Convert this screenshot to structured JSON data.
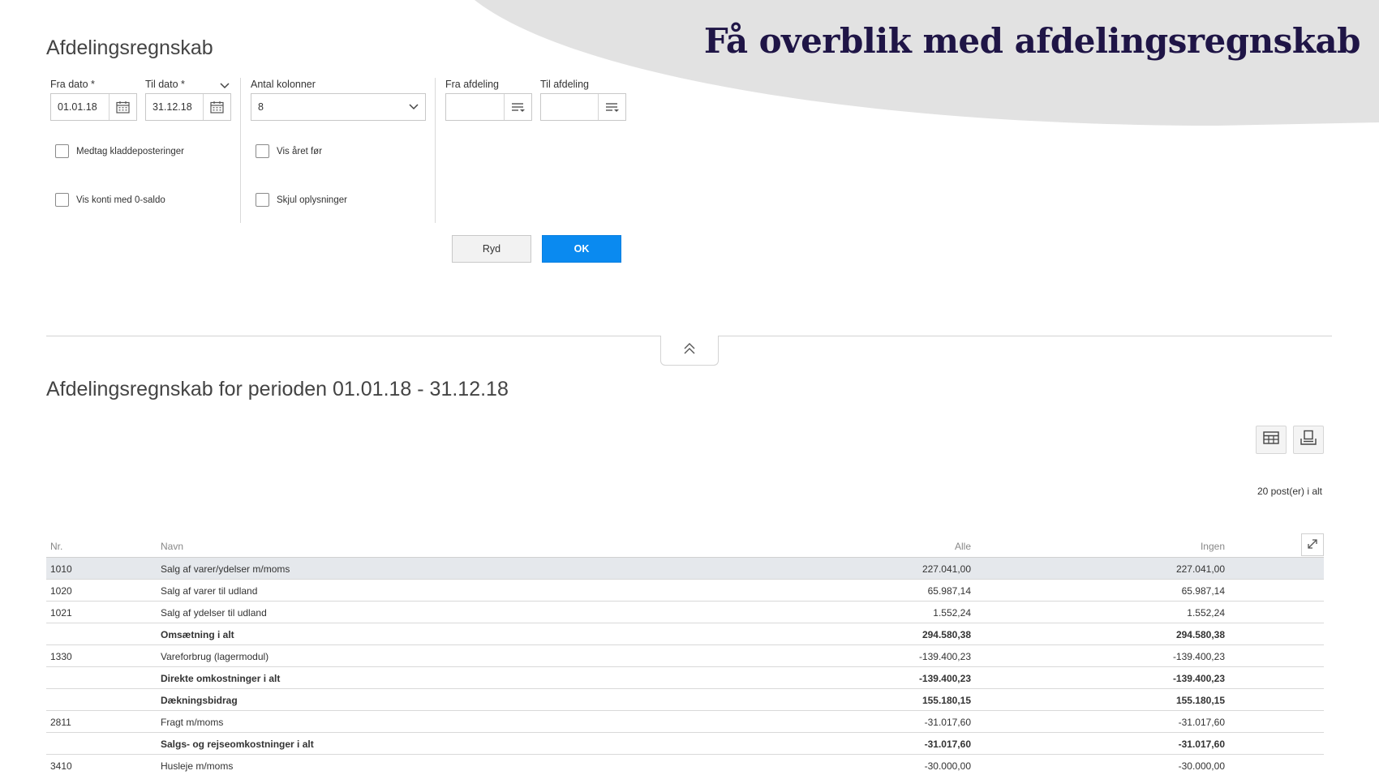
{
  "banner": {
    "title": "Få overblik med afdelingsregnskab"
  },
  "page": {
    "title": "Afdelingsregnskab"
  },
  "filters": {
    "fra_dato": {
      "label": "Fra dato *",
      "value": "01.01.18"
    },
    "til_dato": {
      "label": "Til dato *",
      "value": "31.12.18"
    },
    "antal_kolonner": {
      "label": "Antal kolonner",
      "value": "8"
    },
    "fra_afdeling": {
      "label": "Fra afdeling",
      "value": ""
    },
    "til_afdeling": {
      "label": "Til afdeling",
      "value": ""
    },
    "checkboxes": {
      "medtag_kladde": "Medtag kladdeposteringer",
      "vis_konti_0": "Vis konti med 0-saldo",
      "vis_aaret_foer": "Vis året før",
      "skjul_oplysninger": "Skjul oplysninger"
    }
  },
  "actions": {
    "ryd": "Ryd",
    "ok": "OK"
  },
  "report": {
    "title": "Afdelingsregnskab for perioden 01.01.18 - 31.12.18",
    "count": "20 post(er) i alt",
    "columns": {
      "nr": "Nr.",
      "navn": "Navn",
      "alle": "Alle",
      "ingen": "Ingen"
    },
    "rows": [
      {
        "nr": "1010",
        "navn": "Salg af varer/ydelser m/moms",
        "alle": "227.041,00",
        "ingen": "227.041,00"
      },
      {
        "nr": "1020",
        "navn": "Salg af varer til udland",
        "alle": "65.987,14",
        "ingen": "65.987,14"
      },
      {
        "nr": "1021",
        "navn": "Salg af ydelser til udland",
        "alle": "1.552,24",
        "ingen": "1.552,24"
      },
      {
        "nr": "",
        "navn": "Omsætning i alt",
        "alle": "294.580,38",
        "ingen": "294.580,38"
      },
      {
        "nr": "1330",
        "navn": "Vareforbrug (lagermodul)",
        "alle": "-139.400,23",
        "ingen": "-139.400,23"
      },
      {
        "nr": "",
        "navn": "Direkte omkostninger i alt",
        "alle": "-139.400,23",
        "ingen": "-139.400,23"
      },
      {
        "nr": "",
        "navn": "Dækningsbidrag",
        "alle": "155.180,15",
        "ingen": "155.180,15"
      },
      {
        "nr": "2811",
        "navn": "Fragt m/moms",
        "alle": "-31.017,60",
        "ingen": "-31.017,60"
      },
      {
        "nr": "",
        "navn": "Salgs- og rejseomkostninger i alt",
        "alle": "-31.017,60",
        "ingen": "-31.017,60"
      },
      {
        "nr": "3410",
        "navn": "Husleje m/moms",
        "alle": "-30.000,00",
        "ingen": "-30.000,00"
      }
    ]
  },
  "colors": {
    "primary_button": "#0a8af0",
    "banner_shape": "#e2e2e2",
    "banner_text": "#1f1546",
    "selected_row": "#e5e8ec"
  },
  "icons": [
    "calendar-icon",
    "chevron-down-icon",
    "lookup-list-icon",
    "chevron-double-up-icon",
    "table-icon",
    "print-icon",
    "expand-icon"
  ]
}
